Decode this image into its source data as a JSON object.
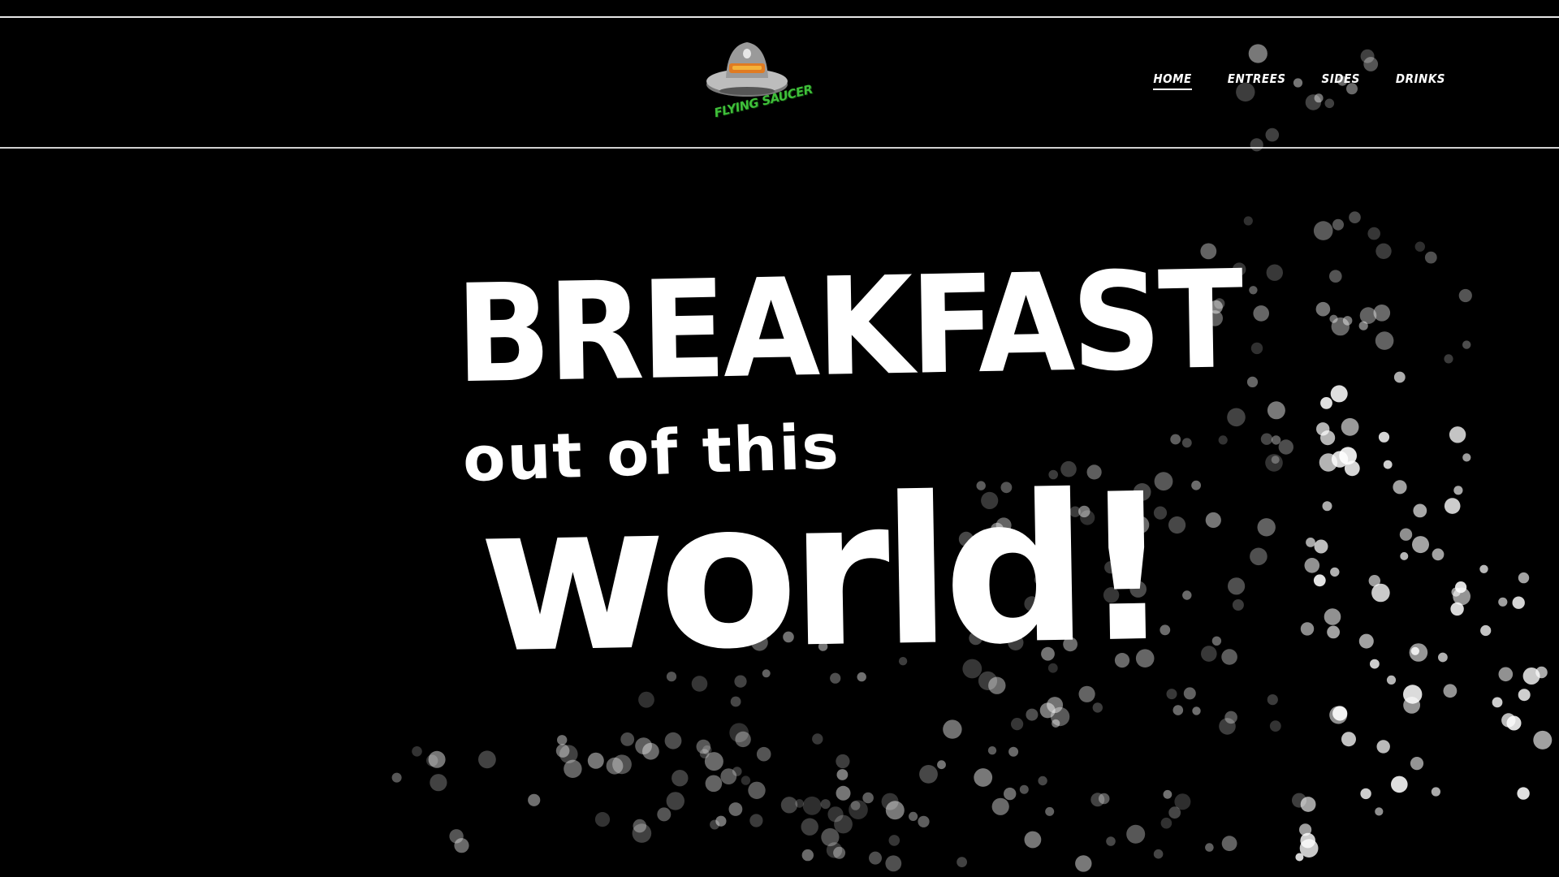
{
  "brand": {
    "logo_text": "FLYING SAUCER",
    "logo_icon": "flying-saucer-icon",
    "logo_colors": {
      "dome": "#9a9a9a",
      "rim": "#bdbdbd",
      "band": "#e07b22",
      "text": "#3fbf3a"
    }
  },
  "nav": {
    "items": [
      {
        "label": "HOME",
        "active": true
      },
      {
        "label": "ENTREES",
        "active": false
      },
      {
        "label": "SIDES",
        "active": false
      },
      {
        "label": "DRINKS",
        "active": false
      }
    ]
  },
  "hero": {
    "line1": "BREAKFAST",
    "line2": "out of this",
    "line3": "world!"
  },
  "colors": {
    "background": "#000000",
    "text": "#ffffff",
    "rule": "#d0d0d0",
    "bubble": "#ffffff"
  }
}
